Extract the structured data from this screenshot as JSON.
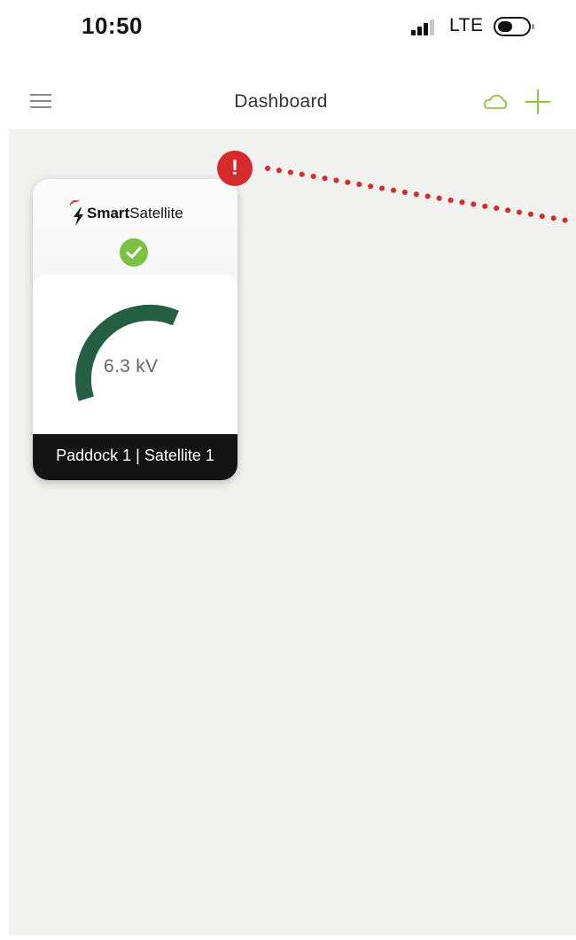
{
  "status_bar": {
    "time": "10:50",
    "network": "LTE",
    "icons": [
      "signal-icon",
      "battery-icon"
    ]
  },
  "nav": {
    "title": "Dashboard",
    "icons": [
      "menu-icon",
      "cloud-icon",
      "add-icon"
    ]
  },
  "alert": {
    "symbol": "!",
    "color": "#d42b2b"
  },
  "device_card": {
    "brand_bold": "Smart",
    "brand_light": "Satellite",
    "status_icon": "check-icon",
    "status_color": "#7cc242",
    "gauge_value": "6.3 kV",
    "gauge_color": "#245e43",
    "label": "Paddock 1 | Satellite 1"
  },
  "colors": {
    "accent": "#8cc63f",
    "background": "#f1f1f0",
    "footer": "#141414"
  }
}
